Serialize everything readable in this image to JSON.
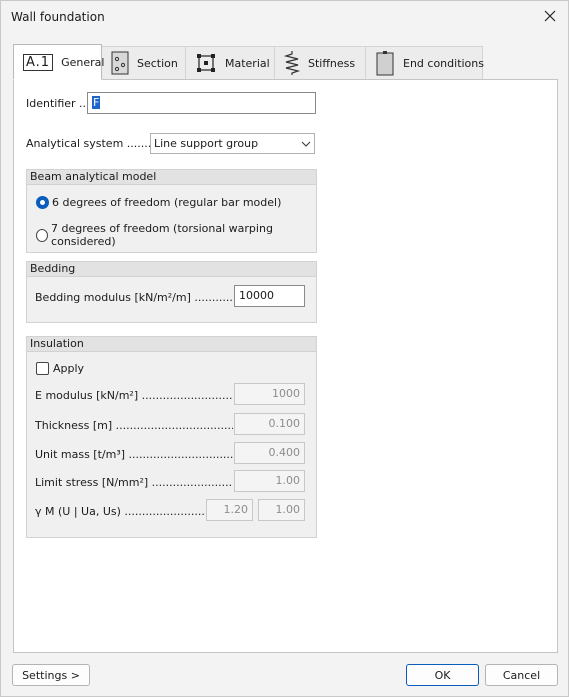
{
  "window": {
    "title": "Wall foundation"
  },
  "tabs": [
    {
      "label": "General",
      "icon": "a1-icon",
      "badge": "A.1"
    },
    {
      "label": "Section",
      "icon": "section-icon"
    },
    {
      "label": "Material",
      "icon": "material-icon"
    },
    {
      "label": "Stiffness",
      "icon": "spring-icon"
    },
    {
      "label": "End conditions",
      "icon": "end-conditions-icon"
    }
  ],
  "general": {
    "identifier_label": "Identifier ...",
    "identifier_value": "F",
    "analytical_label": "Analytical system .........",
    "analytical_value": "Line support group"
  },
  "beam_model": {
    "title": "Beam analytical model",
    "options": [
      {
        "label": "6 degrees of freedom (regular bar model)",
        "selected": true
      },
      {
        "label": "7 degrees of freedom (torsional warping considered)",
        "selected": false
      }
    ]
  },
  "bedding": {
    "title": "Bedding",
    "modulus_label": "Bedding modulus [kN/m²/m] ........................",
    "modulus_value": "10000"
  },
  "insulation": {
    "title": "Insulation",
    "apply_label": "Apply",
    "apply_checked": false,
    "e_modulus_label": "E modulus [kN/m²] ..................................................",
    "e_modulus_value": "1000",
    "thickness_label": "Thickness [m] .............................................................",
    "thickness_value": "0.100",
    "unit_mass_label": "Unit mass [t/m³] ..........................................................",
    "unit_mass_value": "0.400",
    "limit_stress_label": "Limit stress [N/mm²] .................................................",
    "limit_stress_value": "1.00",
    "gamma_label": "γ M (U | Ua, Us) ...............................................",
    "gamma_value_1": "1.20",
    "gamma_value_2": "1.00"
  },
  "footer": {
    "settings_label": "Settings >",
    "ok_label": "OK",
    "cancel_label": "Cancel"
  },
  "colors": {
    "accent": "#0a5dbd"
  }
}
